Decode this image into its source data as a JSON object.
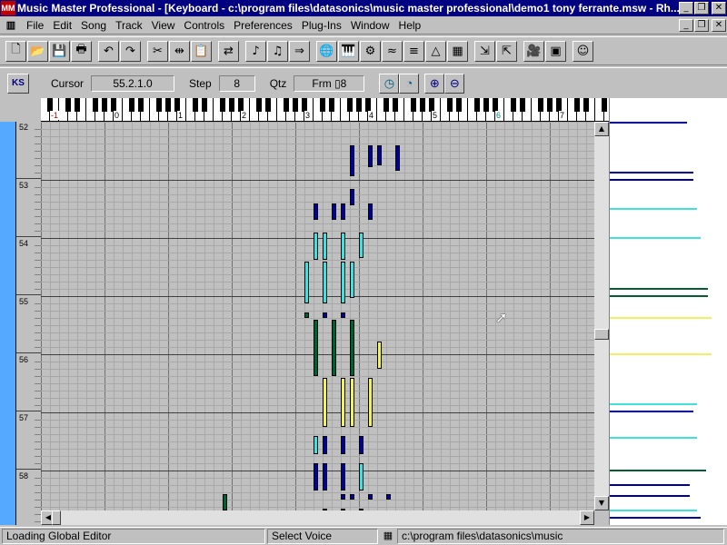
{
  "window": {
    "title": "Music Master Professional - [Keyboard - c:\\program files\\datasonics\\music master professional\\demo1 tony ferrante.msw - Rh...",
    "app_icon": "MM",
    "minimize": "_",
    "restore": "❐",
    "close": "✕"
  },
  "menu": {
    "items": [
      "File",
      "Edit",
      "Song",
      "Track",
      "View",
      "Controls",
      "Preferences",
      "Plug-Ins",
      "Window",
      "Help"
    ],
    "doc_minimize": "_",
    "doc_restore": "❐",
    "doc_close": "✕"
  },
  "toolbar": {
    "buttons": [
      {
        "name": "new-icon",
        "glyph": "🗋"
      },
      {
        "name": "open-icon",
        "glyph": "📂"
      },
      {
        "name": "save-icon",
        "glyph": "💾"
      },
      {
        "name": "print-icon",
        "glyph": "🖶"
      },
      {
        "name": "undo-icon",
        "glyph": "↶"
      },
      {
        "name": "redo-icon",
        "glyph": "↷"
      },
      {
        "name": "cut-icon",
        "glyph": "✂"
      },
      {
        "name": "split-icon",
        "glyph": "⇹"
      },
      {
        "name": "paste-icon",
        "glyph": "📋"
      },
      {
        "name": "swap-icon",
        "glyph": "⇄"
      },
      {
        "name": "note-left-icon",
        "glyph": "♪"
      },
      {
        "name": "note-right-icon",
        "glyph": "♫"
      },
      {
        "name": "forward-icon",
        "glyph": "⇒"
      },
      {
        "name": "globe-icon",
        "glyph": "🌐"
      },
      {
        "name": "keyboard-icon",
        "glyph": "🎹"
      },
      {
        "name": "gear-icon",
        "glyph": "⚙"
      },
      {
        "name": "wave-icon",
        "glyph": "≈"
      },
      {
        "name": "mixer-icon",
        "glyph": "≡"
      },
      {
        "name": "metronome-icon",
        "glyph": "△"
      },
      {
        "name": "sheet-icon",
        "glyph": "▦"
      },
      {
        "name": "import-icon",
        "glyph": "⇲"
      },
      {
        "name": "export-icon",
        "glyph": "⇱"
      },
      {
        "name": "camera-icon",
        "glyph": "🎥"
      },
      {
        "name": "dim-icon",
        "glyph": "▣"
      },
      {
        "name": "smiley-icon",
        "glyph": "☺"
      }
    ]
  },
  "keyboard_toolbar": {
    "ks_label": "KS",
    "cursor_label": "Cursor",
    "cursor_value": "55.2.1.0",
    "step_label": "Step",
    "step_value": "8",
    "qtz_label": "Qtz",
    "qtz_value": "Frm ▯8",
    "tool_clock": "◷",
    "tool_timer": "◔",
    "zoom_in": "⊕",
    "zoom_out": "⊖"
  },
  "piano": {
    "octave_labels": [
      "-1",
      "0",
      "1",
      "2",
      "3",
      "4",
      "5",
      "6",
      "7"
    ],
    "octave_accents": [
      "#c00000",
      "#000",
      "#000",
      "#000",
      "#000",
      "#000",
      "#000",
      "#008080",
      "#000"
    ]
  },
  "measures": [
    "52",
    "53",
    "54",
    "55",
    "56",
    "57",
    "58"
  ],
  "colors": {
    "blue": "#0000a0",
    "cyan": "#40e0e0",
    "green": "#006030",
    "yellow": "#f0f060",
    "rail": "#55aaff"
  },
  "status": {
    "message": "Loading Global Editor",
    "voice": "Select Voice",
    "path": "c:\\program files\\datasonics\\music"
  }
}
